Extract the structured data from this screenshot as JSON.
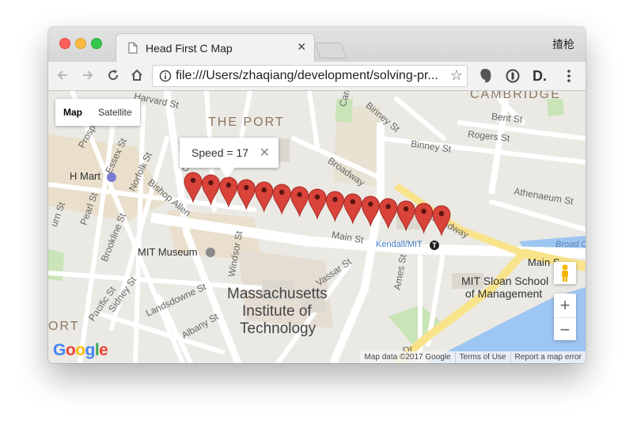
{
  "browser": {
    "tab_title": "Head First C Map",
    "tab_close": "✕",
    "profile_name": "揸枪",
    "url": "file:///Users/zhaqiang/development/solving-pr..."
  },
  "map": {
    "type_control": {
      "map_label": "Map",
      "satellite_label": "Satellite",
      "selected": "Map"
    },
    "info_window": {
      "text": "Speed = 17",
      "close": "✕"
    },
    "labels": {
      "cambridge": "CAMBRIDGE",
      "the_port": "THE PORT",
      "port": "ORT",
      "harvard_st": "Harvard St",
      "binney_st_1": "Binney St",
      "binney_st_2": "Binney St",
      "bent_st": "Bent St",
      "rogers_st": "Rogers St",
      "athenaeum_st": "Athenaeum St",
      "broadway_1": "Broadway",
      "broadway_2": "Broadway",
      "broad_canal": "Broad C",
      "prospect": "Prospec",
      "essex_st": "Essex St",
      "norfolk_st": "Norfolk St",
      "bishop_allen": "Bishop Allen",
      "h_mart": "H Mart",
      "burn_st": "urn St",
      "pearl_st": "Pearl St",
      "brookline_st": "Brookline St",
      "mit_museum": "MIT Museum",
      "windsor_st": "Windsor St",
      "main_st_1": "Main St",
      "main_st_2": "Main S",
      "kendall_mit": "Kendall/MIT",
      "ames_st": "Ames St",
      "vassar_st": "Vassar St",
      "mit_sloan_line1": "MIT Sloan School",
      "mit_sloan_line2": "of Management",
      "massachusetts": "Massachusetts",
      "institute_of": "Institute of",
      "technology": "Technology",
      "sidney_st": "Sidney St",
      "pacific_st": "Pacific St",
      "landsdowne_st": "Landsdowne St",
      "albany_st": "Albany St",
      "col": "Col",
      "card": "Card",
      "dr": "Dr"
    },
    "marker_count": 15,
    "markers_color": "#d9433a",
    "zoom_in": "+",
    "zoom_out": "−",
    "google_logo": {
      "G": "G",
      "o1": "o",
      "o2": "o",
      "g": "g",
      "l": "l",
      "e": "e"
    },
    "attribution": {
      "map_data": "Map data ©2017 Google",
      "terms": "Terms of Use",
      "report": "Report a map error"
    }
  }
}
